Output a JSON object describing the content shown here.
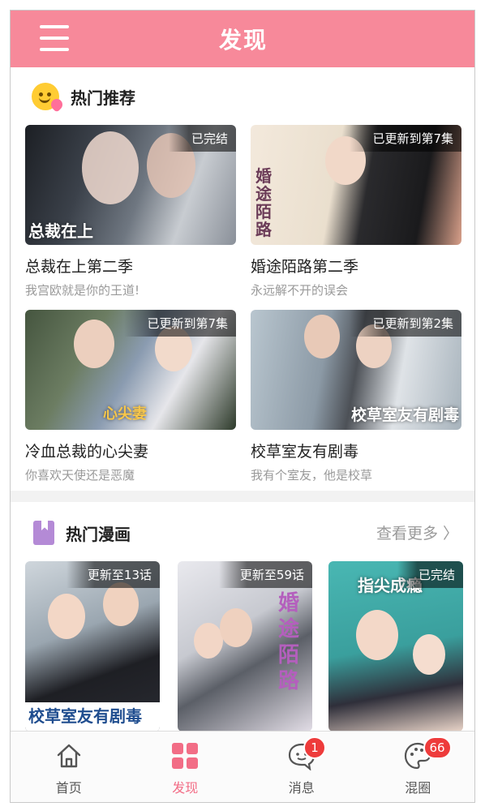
{
  "header": {
    "title": "发现"
  },
  "hot_recommend": {
    "title": "热门推荐",
    "items": [
      {
        "title": "总裁在上第二季",
        "subtitle": "我宫欧就是你的王道!",
        "badge": "已完结",
        "art_text": "总裁在上"
      },
      {
        "title": "婚途陌路第二季",
        "subtitle": "永远解不开的误会",
        "badge": "已更新到第7集",
        "art_text": "婚途陌路"
      },
      {
        "title": "冷血总裁的心尖妻",
        "subtitle": "你喜欢天使还是恶魔",
        "badge": "已更新到第7集",
        "art_text": "心尖妻"
      },
      {
        "title": "校草室友有剧毒",
        "subtitle": "我有个室友，他是校草",
        "badge": "已更新到第2集",
        "art_text": "校草室友有剧毒"
      }
    ]
  },
  "hot_comics": {
    "title": "热门漫画",
    "see_more": "查看更多 〉",
    "items": [
      {
        "badge": "更新至13话",
        "art_text": "校草室友有剧毒"
      },
      {
        "badge": "更新至59话",
        "art_text": "婚途陌路"
      },
      {
        "badge": "已完结",
        "art_text": "指尖成瘾"
      }
    ]
  },
  "tabbar": {
    "tabs": [
      {
        "label": "首页",
        "icon": "home-icon"
      },
      {
        "label": "发现",
        "icon": "grid-icon",
        "active": true
      },
      {
        "label": "消息",
        "icon": "chat-icon",
        "badge": "1"
      },
      {
        "label": "混圈",
        "icon": "palette-icon",
        "badge": "66"
      }
    ]
  },
  "colors": {
    "accent": "#f7899a",
    "active_tab": "#f26d86",
    "badge": "#ee3b3b"
  }
}
